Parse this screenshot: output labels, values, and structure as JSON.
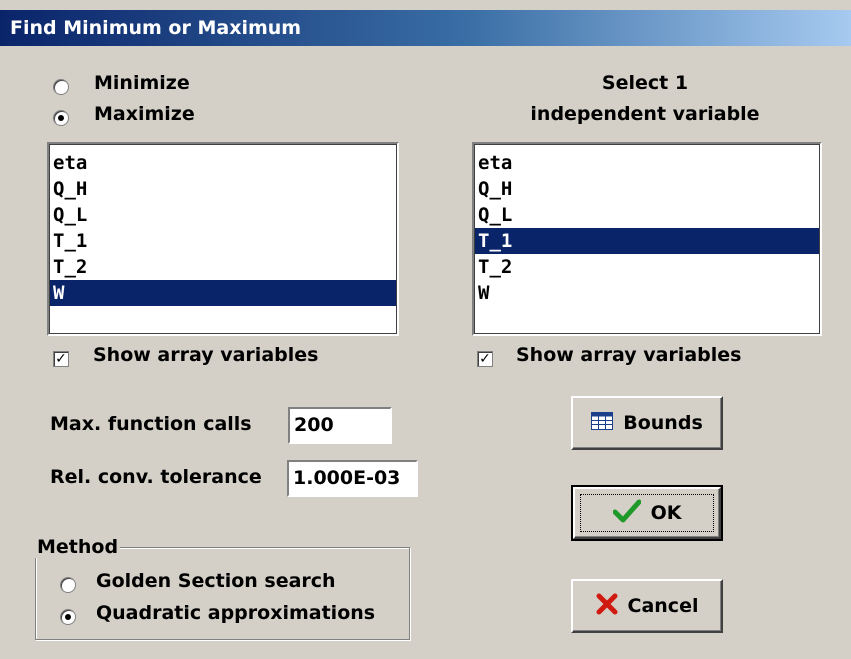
{
  "window": {
    "title": "Find Minimum or Maximum"
  },
  "objective": {
    "options": [
      {
        "label": "Minimize",
        "selected": false
      },
      {
        "label": "Maximize",
        "selected": true
      }
    ]
  },
  "independent": {
    "heading_line1": "Select 1",
    "heading_line2": "independent variable"
  },
  "left_list": {
    "items": [
      "eta",
      "Q_H",
      "Q_L",
      "T_1",
      "T_2",
      "W"
    ],
    "selected": "W",
    "show_array_label": "Show array variables",
    "show_array_checked": true
  },
  "right_list": {
    "items": [
      "eta",
      "Q_H",
      "Q_L",
      "T_1",
      "T_2",
      "W"
    ],
    "selected": "T_1",
    "show_array_label": "Show array variables",
    "show_array_checked": true
  },
  "settings": {
    "max_calls_label": "Max. function calls",
    "max_calls_value": "200",
    "tolerance_label": "Rel. conv. tolerance",
    "tolerance_value": "1.000E-03"
  },
  "method": {
    "title": "Method",
    "options": [
      {
        "label": "Golden Section search",
        "selected": false
      },
      {
        "label": "Quadratic approximations",
        "selected": true
      }
    ]
  },
  "buttons": {
    "bounds": "Bounds",
    "ok": "OK",
    "cancel": "Cancel"
  },
  "colors": {
    "selection": "#0a246a",
    "face": "#d4d0c8",
    "ok_check": "#1f9a2a",
    "cancel_x": "#d11a0f"
  },
  "icons": {
    "bounds": "table-icon",
    "ok": "check-icon",
    "cancel": "x-icon"
  }
}
